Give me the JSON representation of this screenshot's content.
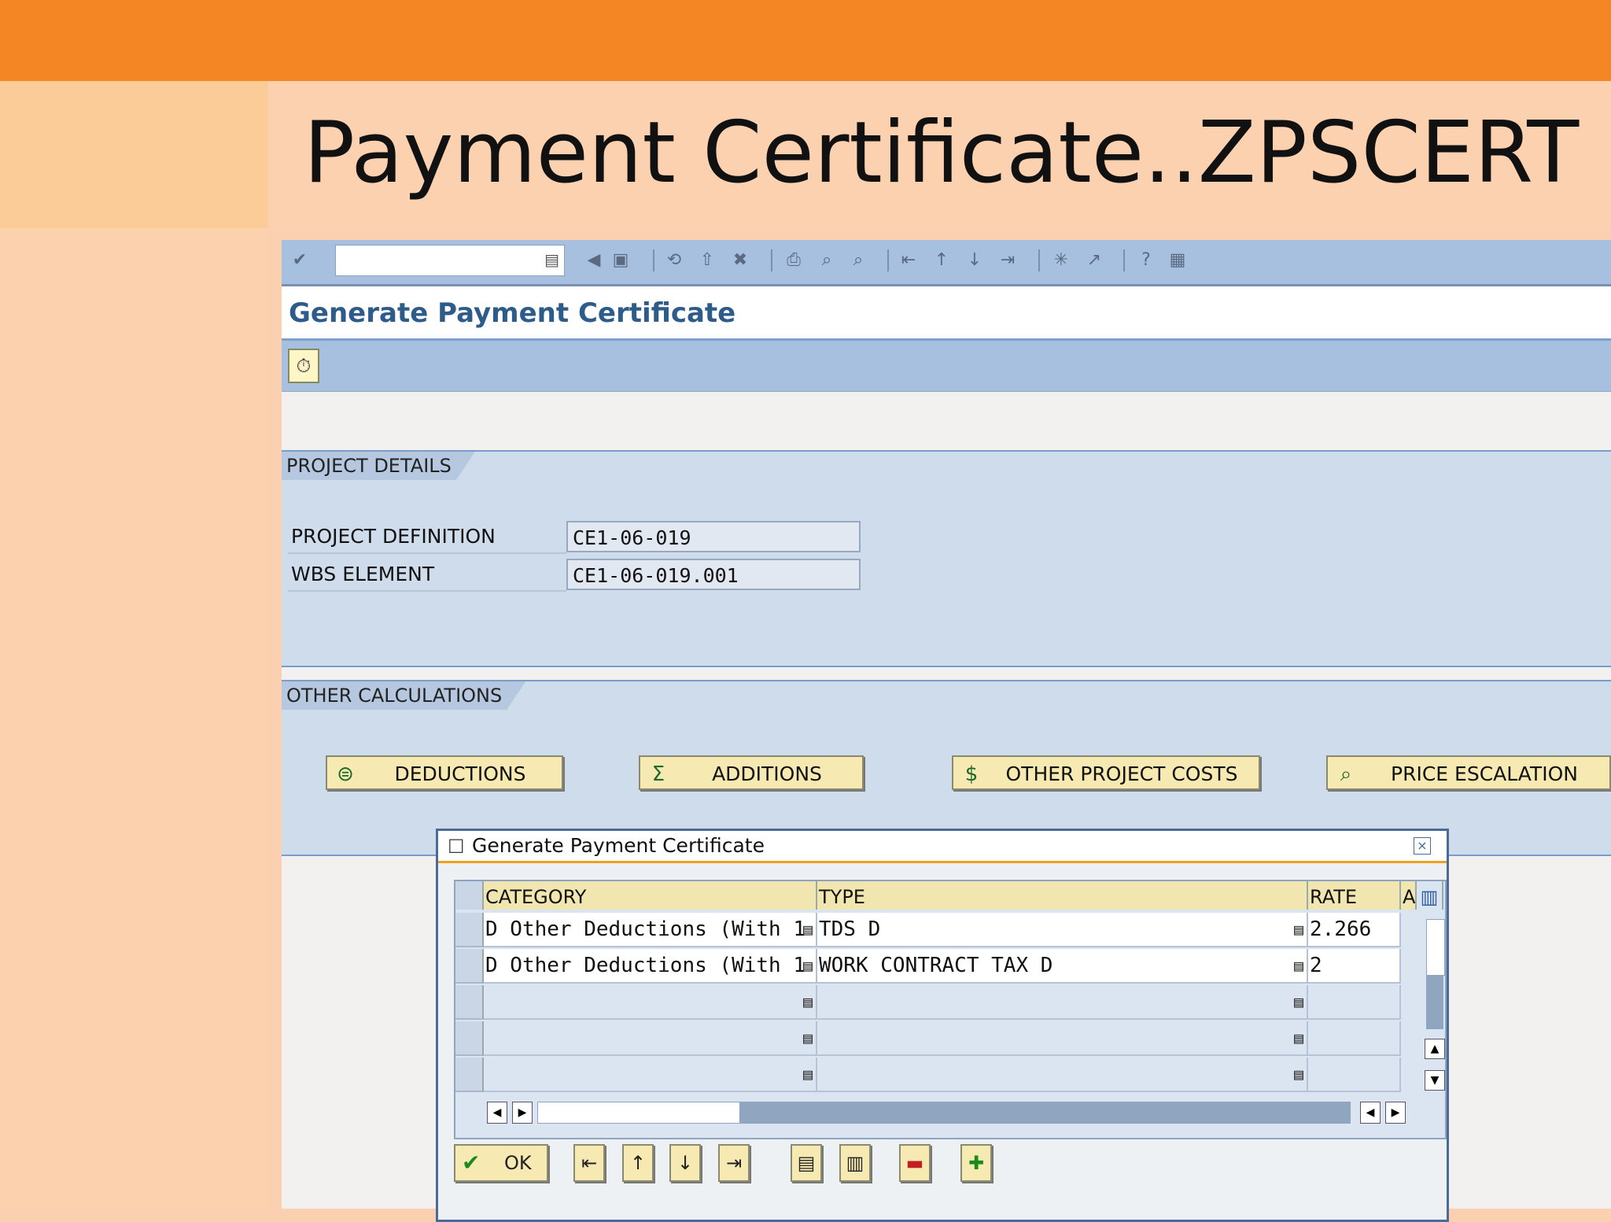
{
  "slide": {
    "title": "Payment Certificate..ZPSCERT"
  },
  "toolbar": {
    "icons": [
      "enter-icon",
      "command-field-dropdown-icon",
      "back-icon",
      "save-icon",
      "back-nav-icon",
      "exit-icon",
      "cancel-icon",
      "print-icon",
      "find-icon",
      "find-next-icon",
      "first-page-icon",
      "previous-page-icon",
      "next-page-icon",
      "last-page-icon",
      "new-session-icon",
      "shortcut-icon",
      "help-icon",
      "layout-icon"
    ]
  },
  "screen": {
    "title": "Generate Payment Certificate",
    "execute_icon": "execute-icon"
  },
  "project_details": {
    "tab": "PROJECT DETAILS",
    "project_definition_label": "PROJECT DEFINITION",
    "project_definition_value": "CE1-06-019",
    "wbs_element_label": "WBS ELEMENT",
    "wbs_element_value": "CE1-06-019.001"
  },
  "other_calculations": {
    "tab": "OTHER CALCULATIONS",
    "deductions": "DEDUCTIONS",
    "additions": "ADDITIONS",
    "other_project_costs": "OTHER PROJECT COSTS",
    "price_escalation": "PRICE ESCALATION"
  },
  "dialog": {
    "title": "Generate Payment Certificate",
    "columns": {
      "category": "CATEGORY",
      "type": "TYPE",
      "rate": "RATE",
      "a": "A"
    },
    "rows": [
      {
        "category": "D Other Deductions (With 1",
        "type": "TDS D",
        "rate": "2.266"
      },
      {
        "category": "D Other Deductions (With 1",
        "type": "WORK CONTRACT TAX D",
        "rate": "2"
      },
      {
        "category": "",
        "type": "",
        "rate": ""
      },
      {
        "category": "",
        "type": "",
        "rate": ""
      },
      {
        "category": "",
        "type": "",
        "rate": ""
      }
    ],
    "ok_label": "OK"
  },
  "colors": {
    "accent": "#f58624",
    "sap_toolbar": "#a8c0e0",
    "button_fill": "#f6e9b1"
  }
}
